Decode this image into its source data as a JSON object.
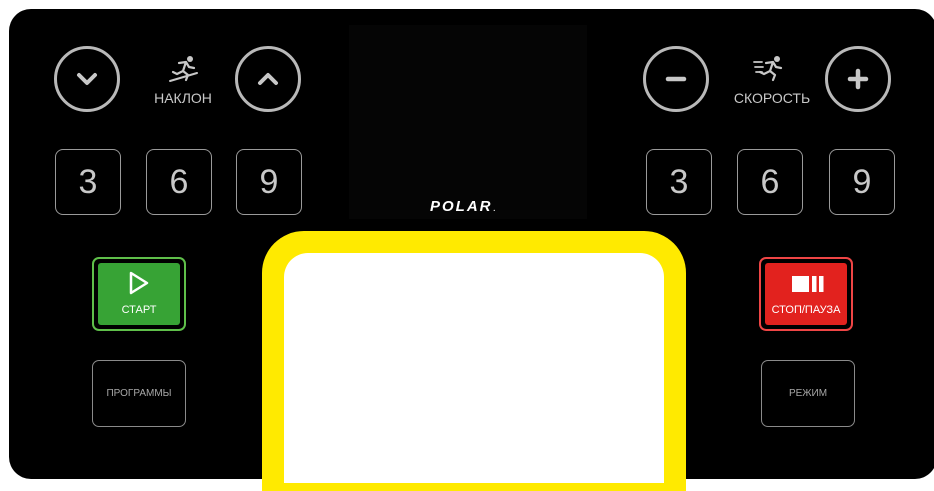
{
  "brand": {
    "name": "POLAR",
    "mark": "."
  },
  "incline": {
    "label": "НАКЛОН",
    "icon": "incline-runner-icon",
    "down_icon": "chevron-down-icon",
    "up_icon": "chevron-up-icon",
    "presets": [
      "3",
      "6",
      "9"
    ]
  },
  "speed": {
    "label": "СКОРОСТЬ",
    "icon": "speed-runner-icon",
    "minus_icon": "minus-icon",
    "plus_icon": "plus-icon",
    "presets": [
      "3",
      "6",
      "9"
    ]
  },
  "controls": {
    "start_label": "СТАРТ",
    "start_icon": "play-icon",
    "stop_label": "СТОП/ПАУЗА",
    "stop_icon": "stop-pause-icon",
    "programs_label": "ПРОГРАММЫ",
    "mode_label": "РЕЖИМ"
  },
  "colors": {
    "panel": "#000000",
    "start": "#37a335",
    "stop": "#e2221e",
    "frame": "#ffea00"
  }
}
